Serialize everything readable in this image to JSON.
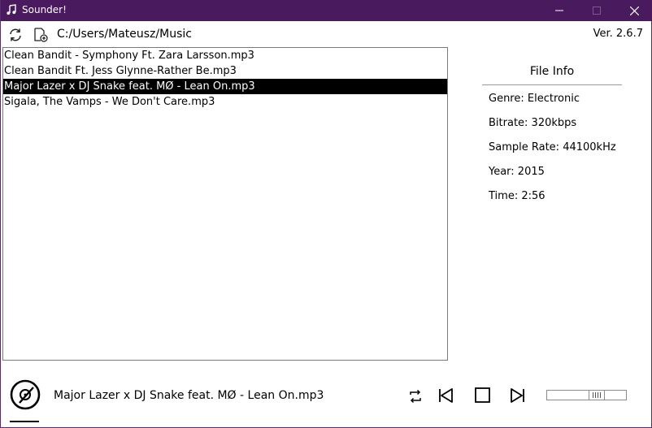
{
  "window": {
    "title": "Sounder!",
    "titlebar_color": "#4a1a5e"
  },
  "toolbar": {
    "refresh_icon": "refresh-icon",
    "add_file_icon": "add-file-icon",
    "path": "C:/Users/Mateusz/Music",
    "version": "Ver. 2.6.7"
  },
  "files": [
    {
      "name": "Clean Bandit - Symphony Ft. Zara Larsson.mp3",
      "selected": false
    },
    {
      "name": "Clean Bandit Ft. Jess Glynne-Rather Be.mp3",
      "selected": false
    },
    {
      "name": "Major Lazer x DJ Snake feat. MØ - Lean On.mp3",
      "selected": true
    },
    {
      "name": "Sigala, The Vamps - We Don't Care.mp3",
      "selected": false
    }
  ],
  "file_info": {
    "title": "File Info",
    "genre": "Genre: Electronic",
    "bitrate": "Bitrate: 320kbps",
    "sample_rate": "Sample Rate: 44100kHz",
    "year": "Year: 2015",
    "time": "Time: 2:56"
  },
  "player": {
    "now_playing": "Major Lazer x DJ Snake feat. MØ - Lean On.mp3",
    "volume": 0.65,
    "icons": [
      "disc-icon",
      "repeat-icon",
      "previous-icon",
      "stop-icon",
      "next-icon"
    ]
  }
}
